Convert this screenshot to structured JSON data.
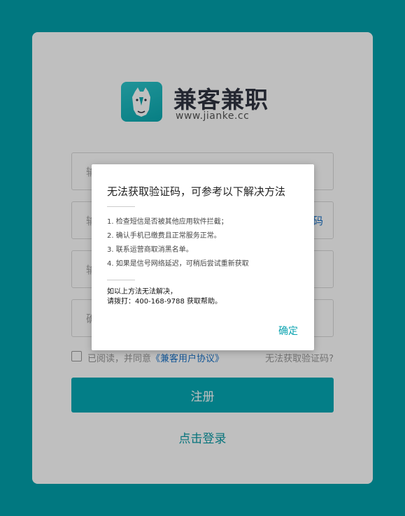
{
  "brand": {
    "name": "兼客兼职",
    "url": "www.jianke.cc"
  },
  "form": {
    "field1_placeholder": "输",
    "field2_placeholder": "输",
    "field2_side_link": "码",
    "field3_placeholder": "输",
    "field4_placeholder": "确",
    "agree_prefix": "已阅读，并同意",
    "agree_link": "《兼客用户协议》",
    "cant_get_code": "无法获取验证码?",
    "register_label": "注册",
    "login_label": "点击登录"
  },
  "dialog": {
    "title": "无法获取验证码，可参考以下解决方法",
    "tips": [
      "1. 检查短信是否被其他应用软件拦截；",
      "2. 确认手机已缴费且正常服务正常。",
      "3. 联系运营商取消黑名单。",
      "4. 如果是信号网络延迟，可稍后尝试重新获取"
    ],
    "help_line1": "如以上方法无法解决，",
    "help_line2": "请拨打：400-168-9788 获取帮助。",
    "ok_label": "确定"
  },
  "colors": {
    "background": "#017880",
    "accent": "#04a9b5",
    "link": "#1a73c8"
  }
}
